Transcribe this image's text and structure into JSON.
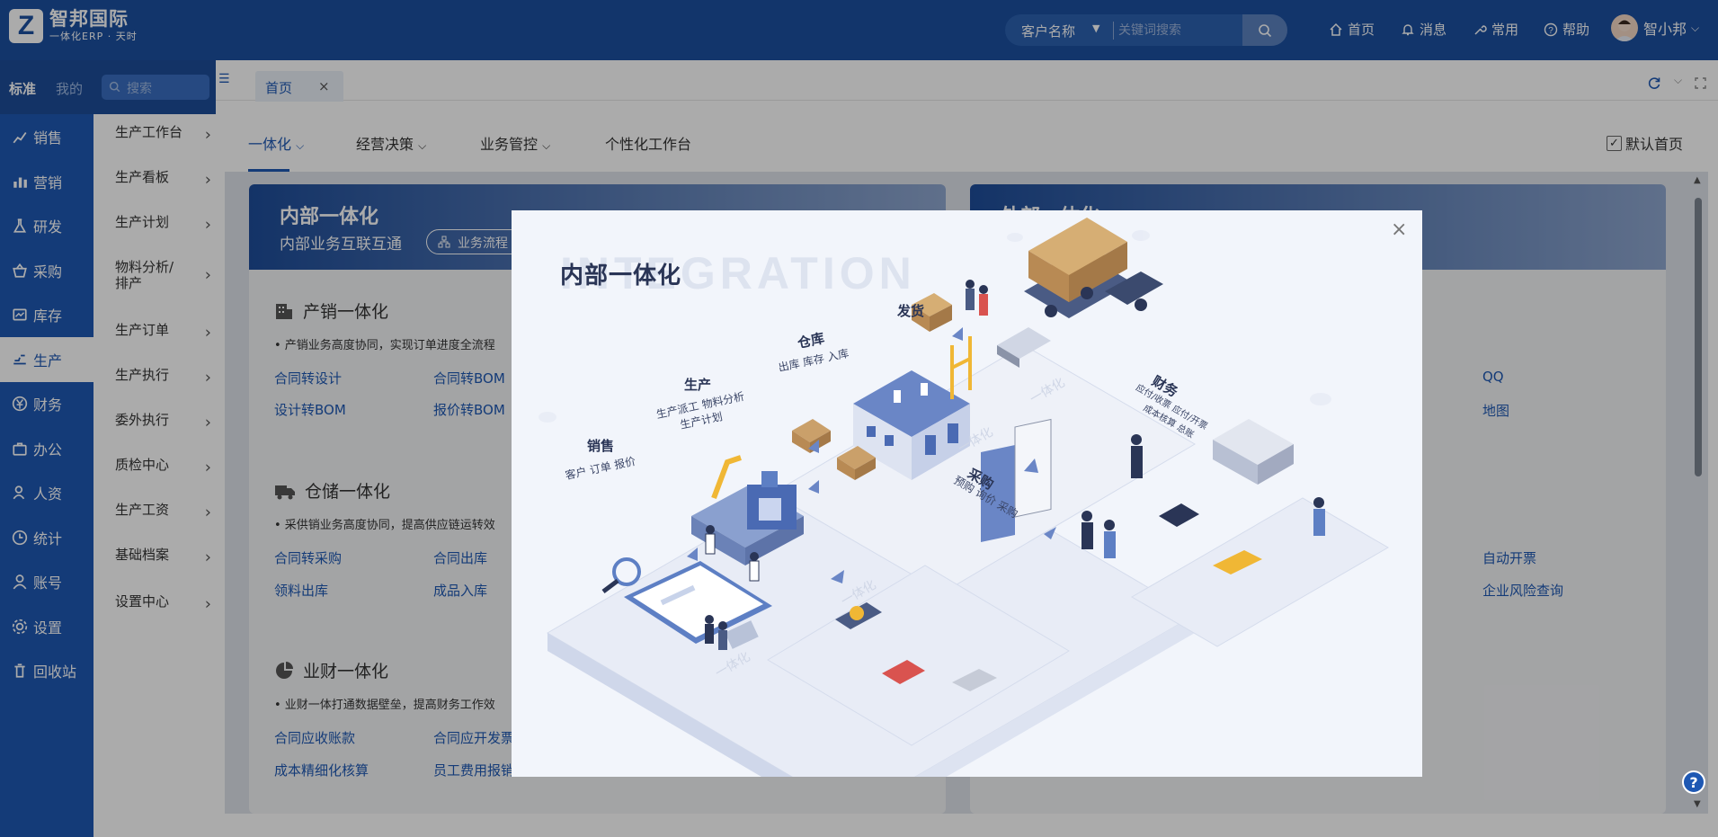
{
  "brand": {
    "logo_letter": "Z",
    "name": "智邦国际",
    "tagline": "一体化ERP · 天时"
  },
  "search": {
    "field": "客户名称",
    "placeholder": "关键词搜索"
  },
  "topnav": [
    {
      "label": "首页",
      "icon": "home-icon"
    },
    {
      "label": "消息",
      "icon": "bell-icon"
    },
    {
      "label": "常用",
      "icon": "wrench-icon"
    },
    {
      "label": "帮助",
      "icon": "help-icon"
    }
  ],
  "user": {
    "name": "智小邦"
  },
  "sidebar_tabs": {
    "standard": "标准",
    "mine": "我的",
    "search_placeholder": "搜索"
  },
  "sidebar": [
    {
      "label": "销售"
    },
    {
      "label": "营销"
    },
    {
      "label": "研发"
    },
    {
      "label": "采购"
    },
    {
      "label": "库存"
    },
    {
      "label": "生产"
    },
    {
      "label": "财务"
    },
    {
      "label": "办公"
    },
    {
      "label": "人资"
    },
    {
      "label": "统计"
    },
    {
      "label": "账号"
    },
    {
      "label": "设置"
    },
    {
      "label": "回收站"
    }
  ],
  "active_module": "生产",
  "submenu": [
    {
      "label": "生产工作台"
    },
    {
      "label": "生产看板"
    },
    {
      "label": "生产计划"
    },
    {
      "label": "物料分析/排产"
    },
    {
      "label": "生产订单"
    },
    {
      "label": "生产执行"
    },
    {
      "label": "委外执行"
    },
    {
      "label": "质检中心"
    },
    {
      "label": "生产工资"
    },
    {
      "label": "基础档案"
    },
    {
      "label": "设置中心"
    }
  ],
  "tab": {
    "label": "首页",
    "close": "×"
  },
  "subnav": [
    {
      "label": "一体化",
      "active": true
    },
    {
      "label": "经营决策"
    },
    {
      "label": "业务管控"
    },
    {
      "label": "个性化工作台"
    }
  ],
  "default_home": {
    "label": "默认首页",
    "checked": true
  },
  "left_card": {
    "title": "内部一体化",
    "subtitle": "内部业务互联互通",
    "pill": "业务流程",
    "sections": [
      {
        "title": "产销一体化",
        "desc": "• 产销业务高度协同，实现订单进度全流程",
        "links": [
          "合同转设计",
          "合同转BOM",
          "设计转BOM",
          "报价转BOM"
        ]
      },
      {
        "title": "仓储一体化",
        "desc": "• 采供销业务高度协同，提高供应链运转效",
        "links": [
          "合同转采购",
          "合同出库",
          "领料出库",
          "成品入库"
        ]
      },
      {
        "title": "业财一体化",
        "desc": "• 业财一体打通数据壁垒，提高财务工作效",
        "links": [
          "合同应收账款",
          "合同应开发票",
          "成本精细化核算",
          "员工费用报销"
        ]
      }
    ]
  },
  "right_card": {
    "title": "外部一体化",
    "links": [
      "QQ",
      "地图",
      "自动开票",
      "企业风险查询"
    ]
  },
  "modal": {
    "title": "内部一体化",
    "watermark": "INTEGRATION",
    "close": "×",
    "labels": {
      "sales": {
        "title": "销售",
        "sub": "客户  订单  报价"
      },
      "production": {
        "title": "生产",
        "sub1": "生产派工    物料分析",
        "sub2": "生产计划"
      },
      "warehouse": {
        "title": "仓库",
        "sub": "出库  库存  入库"
      },
      "shipping": {
        "title": "发货"
      },
      "purchase": {
        "title": "采购",
        "sub": "预购  询价  采购"
      },
      "finance": {
        "title": "财务",
        "sub1": "应付/收票  应付/开票",
        "sub2": "成本核算  总账"
      }
    }
  },
  "help_fab": "?",
  "colors": {
    "brand": "#1b4fa0",
    "sidebar": "#1e58b3",
    "accent": "#1e58b3"
  }
}
